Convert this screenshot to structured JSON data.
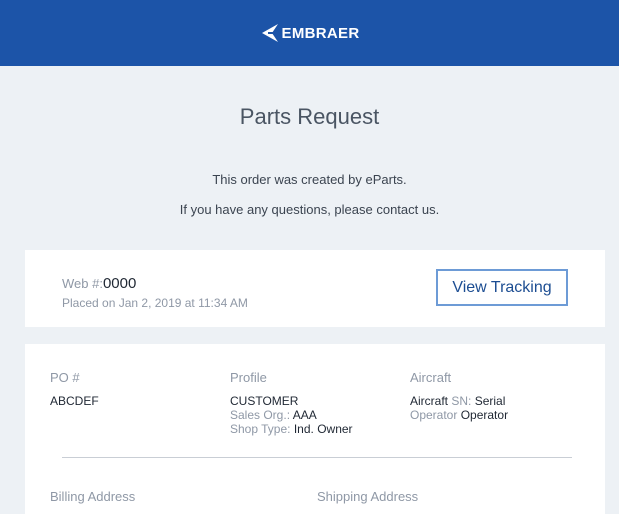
{
  "header": {
    "brand": "EMBRAER"
  },
  "title": "Parts Request",
  "intro": {
    "line1": "This order was created by eParts.",
    "line2": "If you have any questions, please contact us."
  },
  "summary": {
    "web_label": "Web #:",
    "web_number": "0000",
    "placed": "Placed on Jan 2, 2019 at 11:34 AM",
    "tracking_button": "View Tracking"
  },
  "details": {
    "po": {
      "heading": "PO #",
      "value": "ABCDEF"
    },
    "profile": {
      "heading": "Profile",
      "name": "CUSTOMER",
      "sales_org_label": "Sales Org.:",
      "sales_org_value": "AAA",
      "shop_type_label": "Shop Type:",
      "shop_type_value": "Ind. Owner"
    },
    "aircraft": {
      "heading": "Aircraft",
      "aircraft_label": "Aircraft",
      "sn_label": "SN:",
      "sn_value": "Serial",
      "operator_label": "Operator",
      "operator_value": "Operator"
    },
    "billing_heading": "Billing Address",
    "shipping_heading": "Shipping Address"
  },
  "colors": {
    "header_bg": "#1c54a8",
    "page_bg": "#edf1f5",
    "button_border": "#6d9bd6",
    "button_text": "#1c4d92"
  }
}
